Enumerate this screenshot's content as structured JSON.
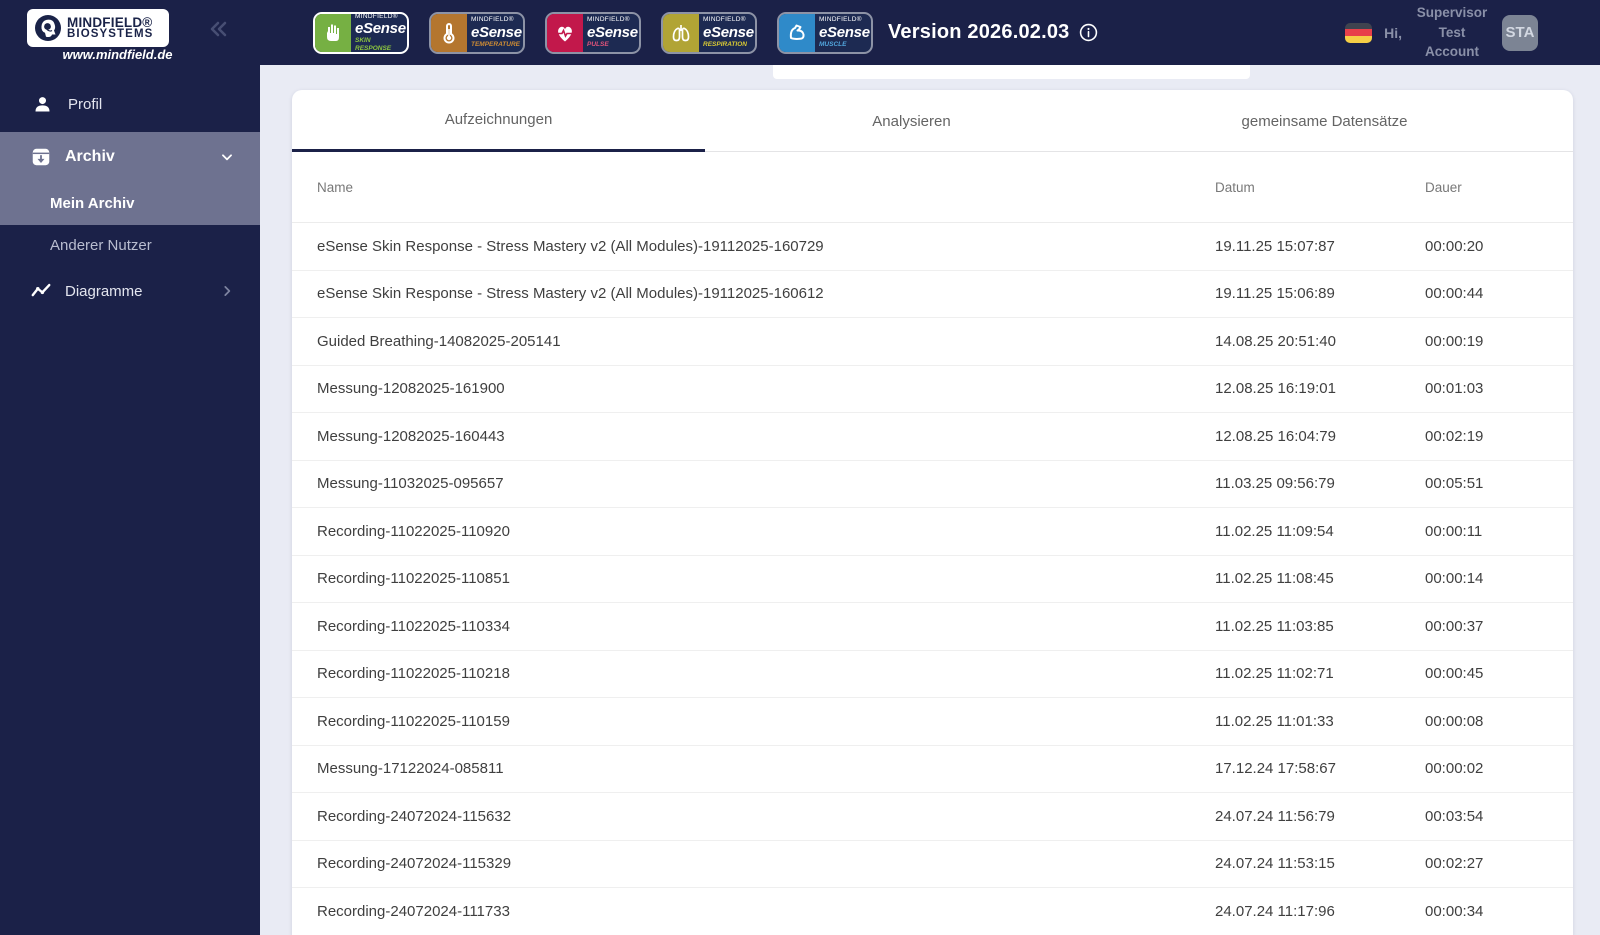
{
  "colors": {
    "navy": "#1b2148",
    "sidebar_highlight": "#6e7290",
    "content_bg": "#e9ebf4",
    "card_bg": "#ffffff",
    "muted_text": "#8a90a8",
    "skin_response_green": "#76b043",
    "temperature_orange": "#b4762f",
    "pulse_red": "#c2184b",
    "respiration_olive": "#b1a435",
    "muscle_blue": "#2f8ac9"
  },
  "sidebar": {
    "logo": {
      "line1": "MINDFIELD®",
      "line2": "BIOSYSTEMS",
      "url": "www.mindfield.de"
    },
    "profil_label": "Profil",
    "archiv_label": "Archiv",
    "mein_archiv_label": "Mein Archiv",
    "anderer_nutzer_label": "Anderer Nutzer",
    "diagramme_label": "Diagramme"
  },
  "header": {
    "badges": [
      {
        "brand": "MINDFIELD®",
        "name": "eSense",
        "product": "SKIN RESPONSE",
        "icon": "hand",
        "color": "#76b043",
        "label_color": "#8dc63f",
        "active": true
      },
      {
        "brand": "MINDFIELD®",
        "name": "eSense",
        "product": "TEMPERATURE",
        "icon": "thermometer",
        "color": "#b4762f",
        "label_color": "#cd8c35",
        "active": false
      },
      {
        "brand": "MINDFIELD®",
        "name": "eSense",
        "product": "PULSE",
        "icon": "heart-pulse",
        "color": "#c2184b",
        "label_color": "#e0537a",
        "active": false
      },
      {
        "brand": "MINDFIELD®",
        "name": "eSense",
        "product": "RESPIRATION",
        "icon": "lungs",
        "color": "#b1a435",
        "label_color": "#d8c934",
        "active": false
      },
      {
        "brand": "MINDFIELD®",
        "name": "eSense",
        "product": "MUSCLE",
        "icon": "muscle-arm",
        "color": "#2f8ac9",
        "label_color": "#52a6dd",
        "active": false
      }
    ],
    "version": "Version 2026.02.03",
    "greeting": "Hi,",
    "account_name": "Supervisor Test Account",
    "avatar_initials": "STA"
  },
  "tabs": [
    {
      "label": "Aufzeichnungen",
      "active": true
    },
    {
      "label": "Analysieren",
      "active": false
    },
    {
      "label": "gemeinsame Datensätze",
      "active": false
    }
  ],
  "table": {
    "columns": {
      "name": "Name",
      "datum": "Datum",
      "dauer": "Dauer"
    },
    "rows": [
      {
        "name": "eSense Skin Response - Stress Mastery v2 (All Modules)-19112025-160729",
        "datum": "19.11.25 15:07:87",
        "dauer": "00:00:20"
      },
      {
        "name": "eSense Skin Response - Stress Mastery v2 (All Modules)-19112025-160612",
        "datum": "19.11.25 15:06:89",
        "dauer": "00:00:44"
      },
      {
        "name": "Guided Breathing-14082025-205141",
        "datum": "14.08.25 20:51:40",
        "dauer": "00:00:19"
      },
      {
        "name": "Messung-12082025-161900",
        "datum": "12.08.25 16:19:01",
        "dauer": "00:01:03"
      },
      {
        "name": "Messung-12082025-160443",
        "datum": "12.08.25 16:04:79",
        "dauer": "00:02:19"
      },
      {
        "name": "Messung-11032025-095657",
        "datum": "11.03.25 09:56:79",
        "dauer": "00:05:51"
      },
      {
        "name": "Recording-11022025-110920",
        "datum": "11.02.25 11:09:54",
        "dauer": "00:00:11"
      },
      {
        "name": "Recording-11022025-110851",
        "datum": "11.02.25 11:08:45",
        "dauer": "00:00:14"
      },
      {
        "name": "Recording-11022025-110334",
        "datum": "11.02.25 11:03:85",
        "dauer": "00:00:37"
      },
      {
        "name": "Recording-11022025-110218",
        "datum": "11.02.25 11:02:71",
        "dauer": "00:00:45"
      },
      {
        "name": "Recording-11022025-110159",
        "datum": "11.02.25 11:01:33",
        "dauer": "00:00:08"
      },
      {
        "name": "Messung-17122024-085811",
        "datum": "17.12.24 17:58:67",
        "dauer": "00:00:02"
      },
      {
        "name": "Recording-24072024-115632",
        "datum": "24.07.24 11:56:79",
        "dauer": "00:03:54"
      },
      {
        "name": "Recording-24072024-115329",
        "datum": "24.07.24 11:53:15",
        "dauer": "00:02:27"
      },
      {
        "name": "Recording-24072024-111733",
        "datum": "24.07.24 11:17:96",
        "dauer": "00:00:34"
      }
    ]
  }
}
